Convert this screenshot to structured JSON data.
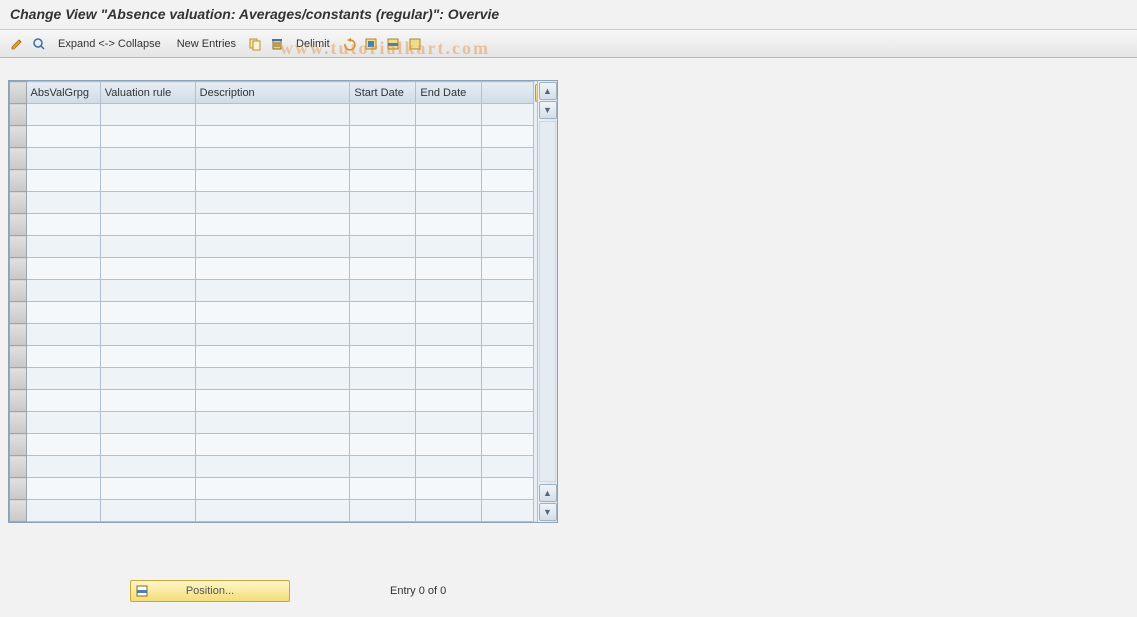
{
  "title": "Change View \"Absence valuation: Averages/constants (regular)\": Overvie",
  "toolbar": {
    "expand_collapse": "Expand <-> Collapse",
    "new_entries": "New Entries",
    "delimit": "Delimit"
  },
  "watermark": "www.tutorialkart.com",
  "table": {
    "columns": {
      "absvalgrpg": "AbsValGrpg",
      "valuation_rule": "Valuation rule",
      "description": "Description",
      "start_date": "Start Date",
      "end_date": "End Date"
    },
    "row_count": 19
  },
  "footer": {
    "position_label": "Position...",
    "entry_text": "Entry 0 of 0"
  }
}
